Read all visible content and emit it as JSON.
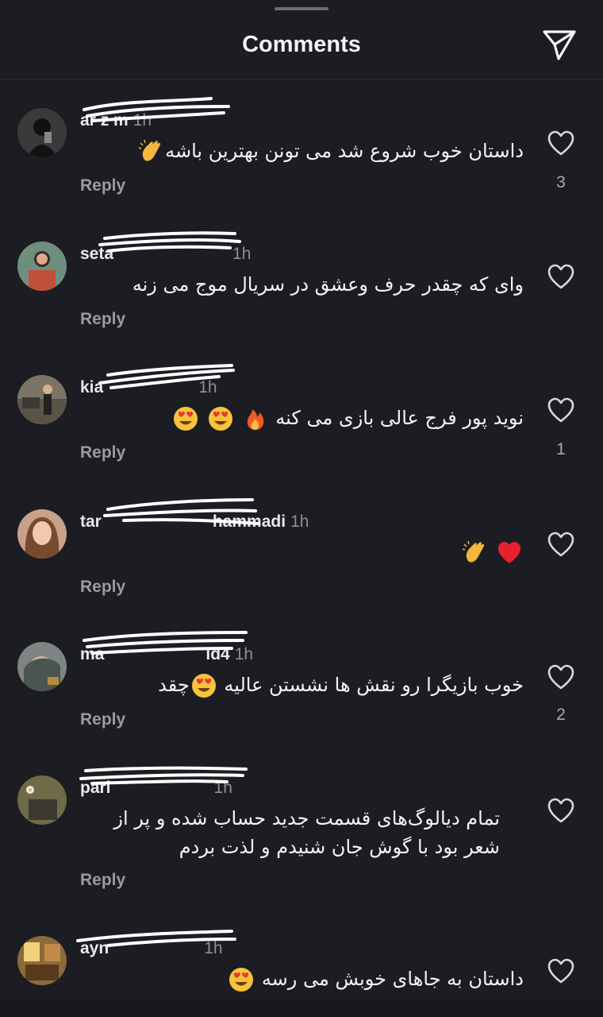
{
  "header": {
    "title": "Comments"
  },
  "icons": {
    "share": "send-icon",
    "like": "heart-icon"
  },
  "comments": [
    {
      "username": "ar",
      "time": "1h",
      "text": "داستان خوب شروع شد می تونن بهترین باشه",
      "emoji": [
        "clap"
      ],
      "reply": "Reply",
      "likes": "3",
      "avatar_color": "#4a4a4a"
    },
    {
      "username": "seta",
      "time": "1h",
      "text": "وای که چقدر حرف وعشق در سریال موج می زنه",
      "emoji": [],
      "reply": "Reply",
      "likes": "",
      "avatar_color": "#5b7b6c"
    },
    {
      "username": "kia",
      "time": "1h",
      "text": "نوید پور فرج عالی بازی می کنه",
      "emoji": [
        "fire",
        "heart-eyes",
        "heart-eyes"
      ],
      "reply": "Reply",
      "likes": "1",
      "avatar_color": "#6f6553"
    },
    {
      "username": "tar",
      "time": "1h",
      "text": "",
      "emoji": [
        "heart",
        "clap"
      ],
      "reply": "Reply",
      "likes": "",
      "username_suffix": "hammadi",
      "avatar_color": "#b98a72"
    },
    {
      "username": "ma",
      "time": "1h",
      "text": "خوب بازیگرا رو نقش ها نشستن عالیه",
      "prefix": "چقد",
      "emoji": [
        "heart-eyes"
      ],
      "reply": "Reply",
      "likes": "2",
      "username_suffix": "ld4",
      "avatar_color": "#6a6f6d"
    },
    {
      "username": "pari",
      "time": "1h",
      "text": "تمام دیالوگ‌های قسمت جدید حساب شده و پر از شعر بود با گوش جان شنیدم و لذت بردم",
      "emoji": [],
      "reply": "Reply",
      "likes": "",
      "avatar_color": "#6f6a4a"
    },
    {
      "username": "ayn",
      "time": "1h",
      "text": "داستان به جاهای خوبش می رسه",
      "emoji": [
        "heart-eyes"
      ],
      "reply": "",
      "likes": "",
      "avatar_color": "#8a6a3a"
    }
  ]
}
